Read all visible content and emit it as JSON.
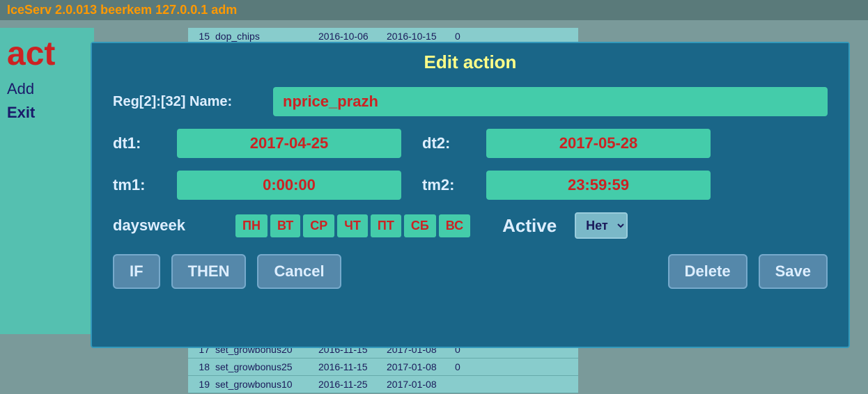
{
  "titlebar": {
    "text": "IceServ 2.0.013 beerkem 127.0.0.1 adm"
  },
  "left_panel": {
    "act_label": "act",
    "add_label": "Add",
    "exit_label": "Exit"
  },
  "bg_table": {
    "rows": [
      {
        "num": "15",
        "name": "dop_chips",
        "date1": "2016-10-06",
        "date2": "2016-10-15",
        "val": "0"
      },
      {
        "num": "17",
        "name": "set_growbonus20",
        "date1": "2016-11-15",
        "date2": "2017-01-08",
        "val": "0"
      },
      {
        "num": "18",
        "name": "set_growbonus25",
        "date1": "2016-11-15",
        "date2": "2017-01-08",
        "val": "0"
      },
      {
        "num": "19",
        "name": "set_growbonus10",
        "date1": "2016-11-25",
        "date2": "2017-01-08",
        "val": ""
      }
    ]
  },
  "modal": {
    "title": "Edit action",
    "reg_label": "Reg[2]:[32] Name:",
    "name_value": "nprice_prazh",
    "dt1_label": "dt1:",
    "dt1_value": "2017-04-25",
    "dt2_label": "dt2:",
    "dt2_value": "2017-05-28",
    "tm1_label": "tm1:",
    "tm1_value": "0:00:00",
    "tm2_label": "tm2:",
    "tm2_value": "23:59:59",
    "daysweek_label": "daysweek",
    "days": [
      "ПН",
      "ВТ",
      "СР",
      "ЧТ",
      "ПТ",
      "СБ",
      "ВС"
    ],
    "active_label": "Active",
    "net_value": "Нет",
    "buttons": {
      "if": "IF",
      "then": "THEN",
      "cancel": "Cancel",
      "delete": "Delete",
      "save": "Save"
    }
  }
}
